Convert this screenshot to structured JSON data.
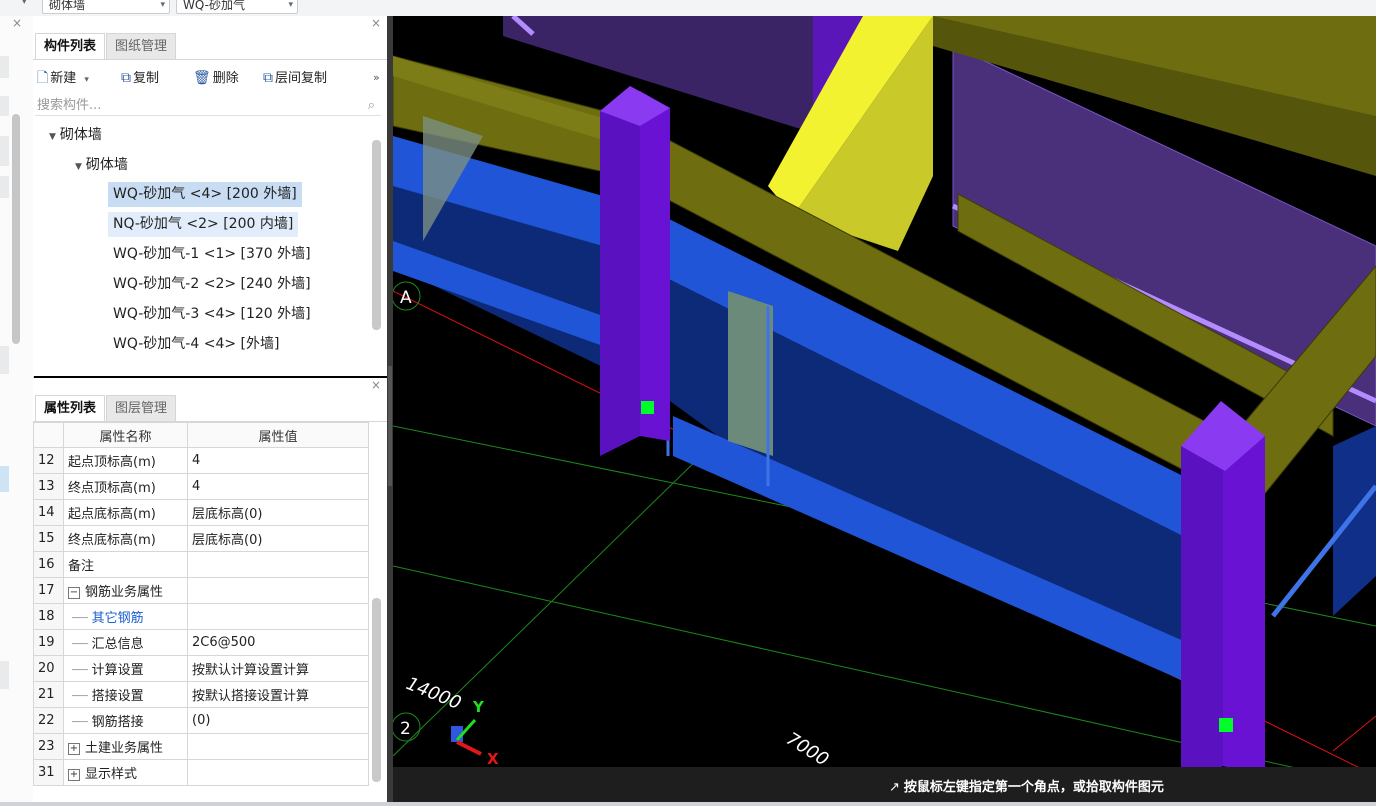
{
  "toolbar": {
    "wall_type_dropdown": "砌体墙",
    "component_dropdown": "WQ-砂加气"
  },
  "component_panel": {
    "tabs": [
      "构件列表",
      "图纸管理"
    ],
    "actions": {
      "new": "新建",
      "copy": "复制",
      "delete": "删除",
      "floor_copy": "层间复制",
      "more": "»"
    },
    "search_placeholder": "搜索构件...",
    "tree": {
      "root": "砌体墙",
      "group": "砌体墙",
      "items": [
        "WQ-砂加气 <4> [200 外墙]",
        "NQ-砂加气 <2> [200 内墙]",
        "WQ-砂加气-1 <1> [370 外墙]",
        "WQ-砂加气-2 <2> [240 外墙]",
        "WQ-砂加气-3 <4> [120 外墙]",
        "WQ-砂加气-4 <4> [外墙]"
      ]
    }
  },
  "property_panel": {
    "tabs": [
      "属性列表",
      "图层管理"
    ],
    "headers": {
      "name": "属性名称",
      "value": "属性值"
    },
    "rows": [
      {
        "num": "12",
        "name": "起点顶标高(m)",
        "value": "4"
      },
      {
        "num": "13",
        "name": "终点顶标高(m)",
        "value": "4"
      },
      {
        "num": "14",
        "name": "起点底标高(m)",
        "value": "层底标高(0)"
      },
      {
        "num": "15",
        "name": "终点底标高(m)",
        "value": "层底标高(0)"
      },
      {
        "num": "16",
        "name": "备注",
        "value": ""
      },
      {
        "num": "17",
        "name": "钢筋业务属性",
        "value": ""
      },
      {
        "num": "18",
        "name": "其它钢筋",
        "value": ""
      },
      {
        "num": "19",
        "name": "汇总信息",
        "value": "2C6@500"
      },
      {
        "num": "20",
        "name": "计算设置",
        "value": "按默认计算设置计算"
      },
      {
        "num": "21",
        "name": "搭接设置",
        "value": "按默认搭接设置计算"
      },
      {
        "num": "22",
        "name": "钢筋搭接",
        "value": "(0)"
      },
      {
        "num": "23",
        "name": "土建业务属性",
        "value": ""
      },
      {
        "num": "31",
        "name": "显示样式",
        "value": ""
      }
    ]
  },
  "viewport": {
    "axis_label_a": "A",
    "axis_label_2": "2",
    "dim_14000": "14000",
    "dim_7000": "7000",
    "axis_x": "X",
    "axis_y": "Y",
    "status_message": "按鼠标左键指定第一个角点，或拾取构件图元",
    "colors": {
      "beam": "#6e6e10",
      "column": "#6a12d4",
      "wall_blue": "#1f55d6",
      "accent_yellow": "#f2f230"
    }
  }
}
